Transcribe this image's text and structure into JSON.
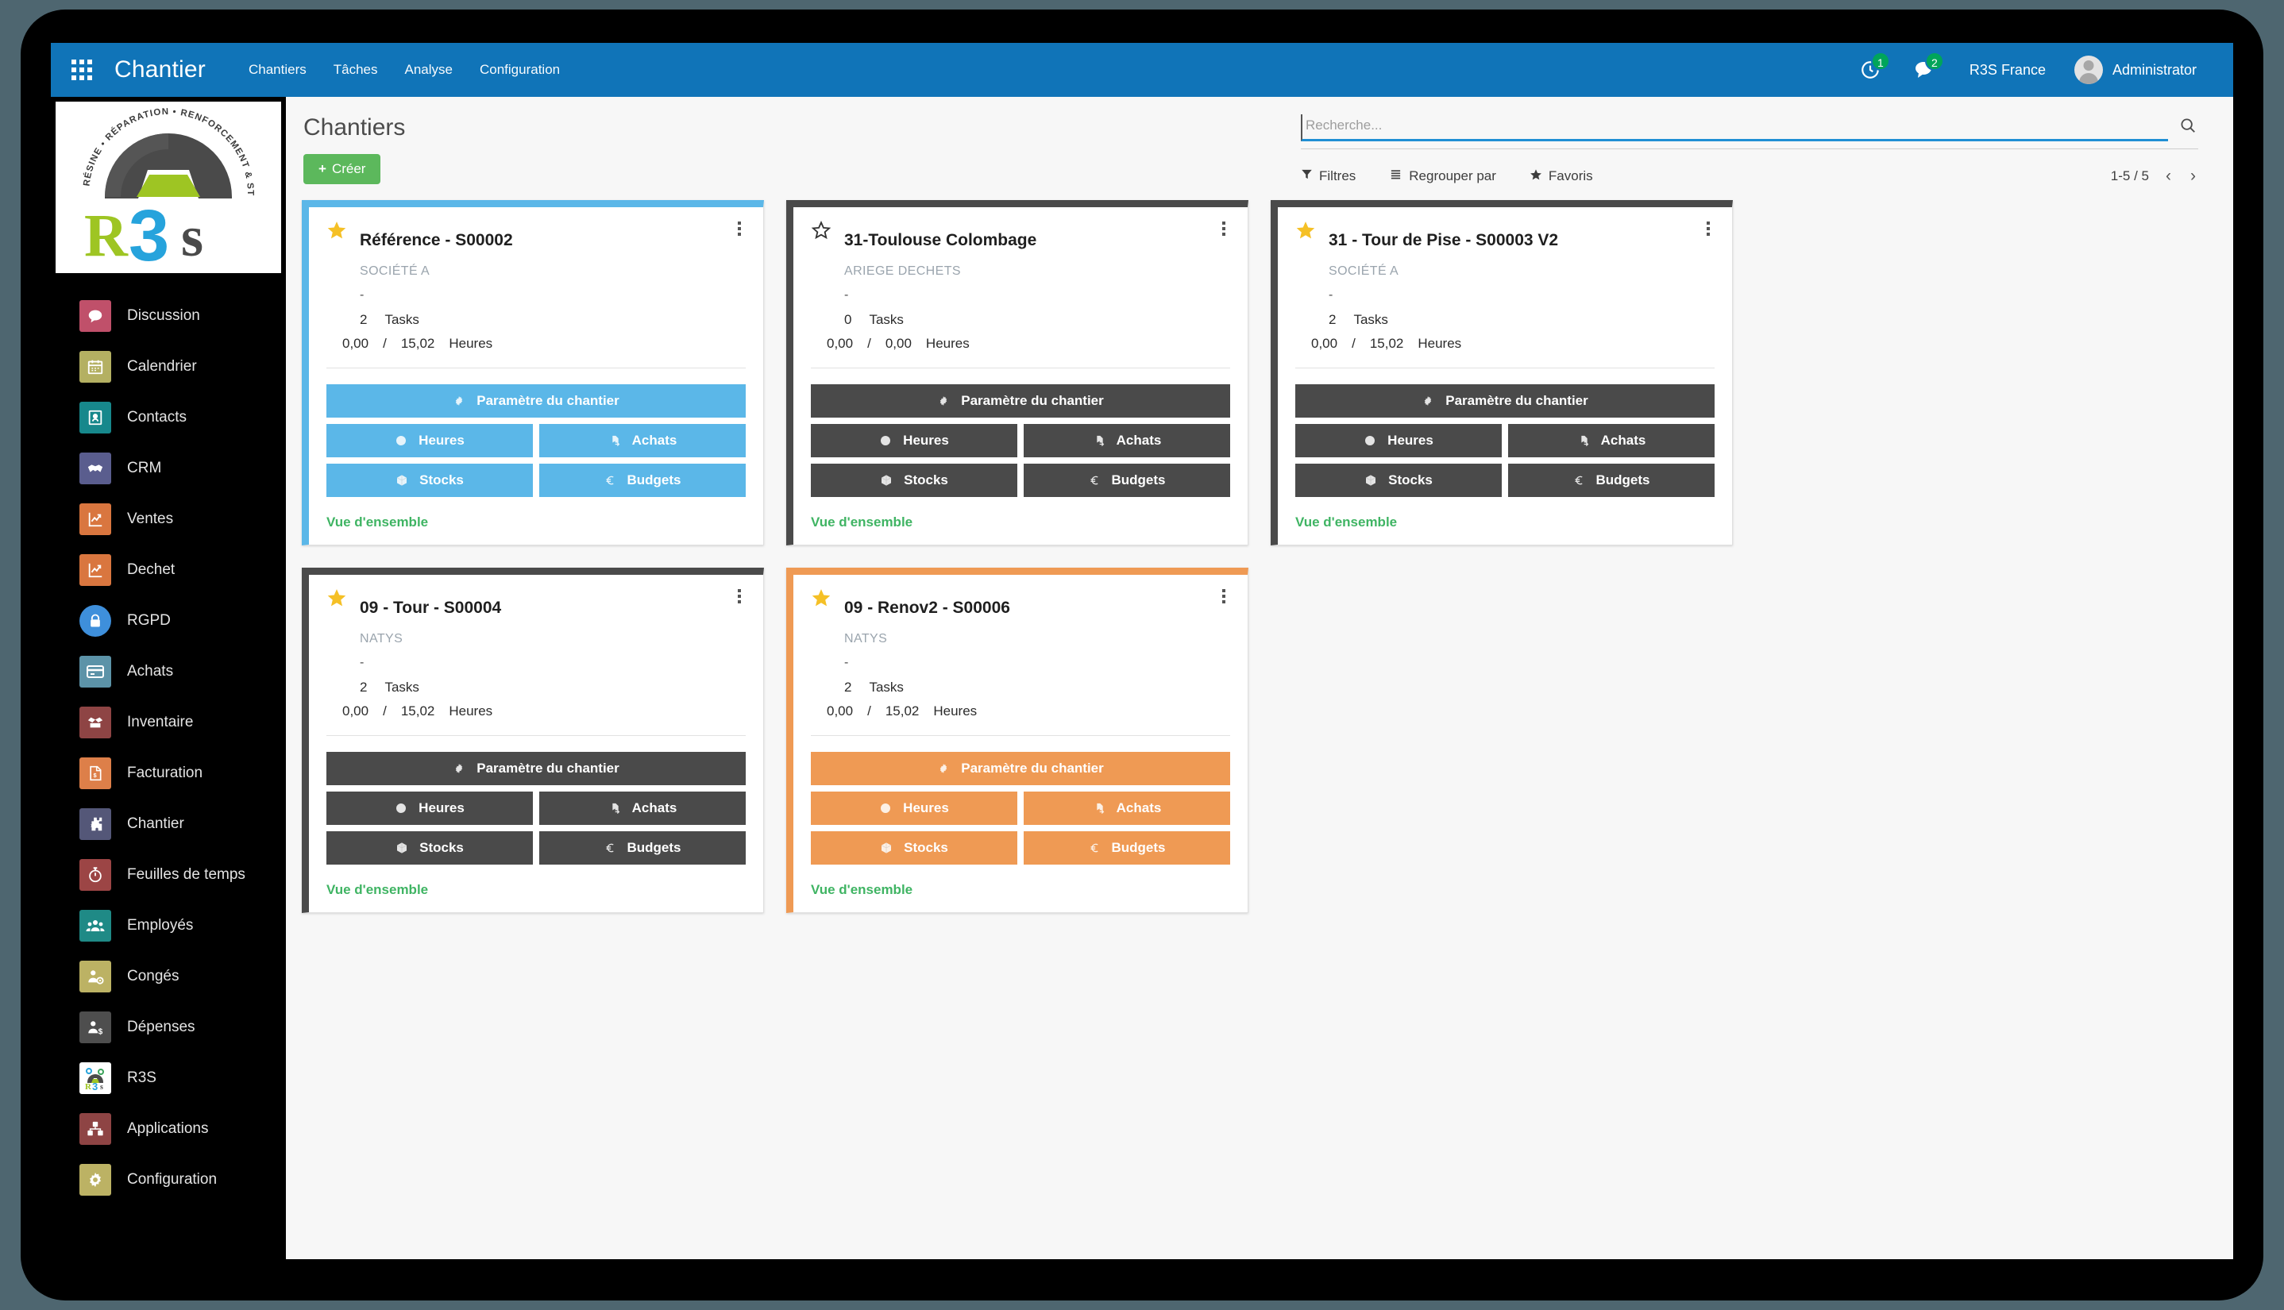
{
  "app_bar": {
    "apps_icon": "apps-grid-icon",
    "title": "Chantier",
    "menu": [
      {
        "label": "Chantiers"
      },
      {
        "label": "Tâches"
      },
      {
        "label": "Analyse"
      },
      {
        "label": "Configuration"
      }
    ],
    "activity_icon": "clock-activity-icon",
    "activity_count": "1",
    "messages_icon": "chat-bubble-icon",
    "messages_count": "2",
    "company": "R3S France",
    "user": "Administrator",
    "bar_color": "#1074b8",
    "badge_color": "#00a55a"
  },
  "logo": {
    "arc_text": "RÉSINE • RÉPARATION • RENFORCEMENT & STRUCTURE",
    "wordmark": "R3S",
    "green": "#9ec523",
    "blue": "#26a3dc",
    "dark": "#4a4a4a"
  },
  "sidebar": {
    "items": [
      {
        "label": "Discussion",
        "icon": "chat-icon",
        "color": "#c0506a"
      },
      {
        "label": "Calendrier",
        "icon": "calendar-icon",
        "color": "#b4b062"
      },
      {
        "label": "Contacts",
        "icon": "contact-book-icon",
        "color": "#17888c"
      },
      {
        "label": "CRM",
        "icon": "handshake-icon",
        "color": "#5a5d8e"
      },
      {
        "label": "Ventes",
        "icon": "chart-up-icon",
        "color": "#d9763f"
      },
      {
        "label": "Dechet",
        "icon": "chart-up-icon",
        "color": "#d9763f"
      },
      {
        "label": "RGPD",
        "icon": "lock-icon",
        "color": "#3e8fdb"
      },
      {
        "label": "Achats",
        "icon": "credit-card-icon",
        "color": "#5c93a8"
      },
      {
        "label": "Inventaire",
        "icon": "box-open-icon",
        "color": "#8e4444"
      },
      {
        "label": "Facturation",
        "icon": "invoice-icon",
        "color": "#dd7f49"
      },
      {
        "label": "Chantier",
        "icon": "puzzle-icon",
        "color": "#545778"
      },
      {
        "label": "Feuilles de temps",
        "icon": "stopwatch-icon",
        "color": "#9c4545"
      },
      {
        "label": "Employés",
        "icon": "people-icon",
        "color": "#1f8a86"
      },
      {
        "label": "Congés",
        "icon": "person-gear-icon",
        "color": "#bcb264"
      },
      {
        "label": "Dépenses",
        "icon": "person-money-icon",
        "color": "#4e4e4e"
      },
      {
        "label": "R3S",
        "icon": "r3s-logo-icon",
        "color": "#ffffff"
      },
      {
        "label": "Applications",
        "icon": "modules-icon",
        "color": "#8e4444"
      },
      {
        "label": "Configuration",
        "icon": "gear-icon",
        "color": "#bcb264"
      }
    ]
  },
  "control_panel": {
    "page_title": "Chantiers",
    "create_label": "Créer",
    "create_plus": "+",
    "search_placeholder": "Recherche...",
    "search_value": "",
    "search_icon": "magnifier-icon",
    "filters_label": "Filtres",
    "filters_icon": "funnel-icon",
    "groupby_label": "Regrouper par",
    "groupby_icon": "list-lines-icon",
    "favorites_label": "Favoris",
    "favorites_icon": "star-icon",
    "pager_text": "1-5 / 5",
    "prev_icon": "chevron-left-icon",
    "next_icon": "chevron-right-icon"
  },
  "card_labels": {
    "settings": "Paramètre du chantier",
    "hours": "Heures",
    "purchases": "Achats",
    "stocks": "Stocks",
    "budgets": "Budgets",
    "overview": "Vue d'ensemble",
    "tasks_word": "Tasks",
    "hours_word": "Heures",
    "dash": "-",
    "slash": "/",
    "settings_icon": "gear-icon",
    "hours_icon": "clock-icon",
    "purchases_icon": "file-export-icon",
    "stocks_icon": "cube-icon",
    "budgets_icon": "euro-icon",
    "menu_icon": "kebab-menu-icon",
    "star_icon": "star-icon"
  },
  "cards": [
    {
      "title": "Référence - S00002",
      "company": "SOCIÉTÉ A",
      "tasks": "2",
      "hours_done": "0,00",
      "hours_total": "15,02",
      "starred": true,
      "accent": "#5bb7e8",
      "button_color": "#5bb7e8"
    },
    {
      "title": "31-Toulouse Colombage",
      "company": "ARIEGE DECHETS",
      "tasks": "0",
      "hours_done": "0,00",
      "hours_total": "0,00",
      "starred": false,
      "accent": "#4a4a4a",
      "button_color": "#4a4a4a"
    },
    {
      "title": "31 - Tour de Pise - S00003 V2",
      "company": "SOCIÉTÉ A",
      "tasks": "2",
      "hours_done": "0,00",
      "hours_total": "15,02",
      "starred": true,
      "accent": "#4a4a4a",
      "button_color": "#4a4a4a"
    },
    {
      "title": "09 - Tour - S00004",
      "company": "NATYS",
      "tasks": "2",
      "hours_done": "0,00",
      "hours_total": "15,02",
      "starred": true,
      "accent": "#4a4a4a",
      "button_color": "#4a4a4a"
    },
    {
      "title": "09 - Renov2 - S00006",
      "company": "NATYS",
      "tasks": "2",
      "hours_done": "0,00",
      "hours_total": "15,02",
      "starred": true,
      "accent": "#ef9a54",
      "button_color": "#ef9a54"
    }
  ]
}
